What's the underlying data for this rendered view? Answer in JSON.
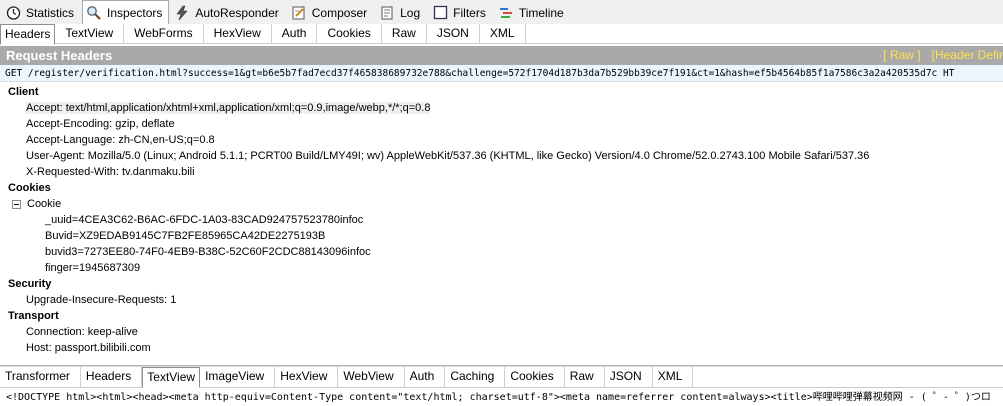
{
  "top_tabs": [
    {
      "label": "Statistics",
      "icon": "stopwatch-icon"
    },
    {
      "label": "Inspectors",
      "icon": "magnifier-icon"
    },
    {
      "label": "AutoResponder",
      "icon": "lightning-icon"
    },
    {
      "label": "Composer",
      "icon": "pencil-document-icon"
    },
    {
      "label": "Log",
      "icon": "log-document-icon"
    },
    {
      "label": "Filters",
      "icon": "checkbox-icon"
    },
    {
      "label": "Timeline",
      "icon": "timeline-icon"
    }
  ],
  "request_tabs": [
    "Headers",
    "TextView",
    "WebForms",
    "HexView",
    "Auth",
    "Cookies",
    "Raw",
    "JSON",
    "XML"
  ],
  "request_header": {
    "title": "Request Headers",
    "raw_link": "[ Raw ]",
    "definitions_link": "[Header Defir"
  },
  "request_line": "GET /register/verification.html?success=1&gt=b6e5b7fad7ecd37f465838689732e788&challenge=572f1704d187b3da7b529bb39ce7f191&ct=1&hash=ef5b4564b85f1a7586c3a2a420535d7c HT",
  "groups": {
    "client": {
      "title": "Client",
      "items": [
        "Accept: text/html,application/xhtml+xml,application/xml;q=0.9,image/webp,*/*;q=0.8",
        "Accept-Encoding: gzip, deflate",
        "Accept-Language: zh-CN,en-US;q=0.8",
        "User-Agent: Mozilla/5.0 (Linux; Android 5.1.1; PCRT00 Build/LMY49I; wv) AppleWebKit/537.36 (KHTML, like Gecko) Version/4.0 Chrome/52.0.2743.100 Mobile Safari/537.36",
        "X-Requested-With: tv.danmaku.bili"
      ]
    },
    "cookies": {
      "title": "Cookies",
      "parent_label": "Cookie",
      "items": [
        "_uuid=4CEA3C62-B6AC-6FDC-1A03-83CAD924757523780infoc",
        "Buvid=XZ9EDAB9145C7FB2FE85965CA42DE2275193B",
        "buvid3=7273EE80-74F0-4EB9-B38C-52C60F2CDC88143096infoc",
        "finger=1945687309"
      ]
    },
    "security": {
      "title": "Security",
      "items": [
        "Upgrade-Insecure-Requests: 1"
      ]
    },
    "transport": {
      "title": "Transport",
      "items": [
        "Connection: keep-alive",
        "Host: passport.bilibili.com"
      ]
    }
  },
  "response_tabs": [
    "Transformer",
    "Headers",
    "TextView",
    "ImageView",
    "HexView",
    "WebView",
    "Auth",
    "Caching",
    "Cookies",
    "Raw",
    "JSON",
    "XML"
  ],
  "response_body": "<!DOCTYPE html><html><head><meta http-equiv=Content-Type content=\"text/html; charset=utf-8\"><meta name=referrer content=always><title>哔哩哔哩弹幕视频网 - ( ゜- ゜)つロ",
  "colors": {
    "header_bar": "#a9a9a9",
    "header_links": "#ffe34a",
    "request_line_bg": "#eaf5fd"
  }
}
